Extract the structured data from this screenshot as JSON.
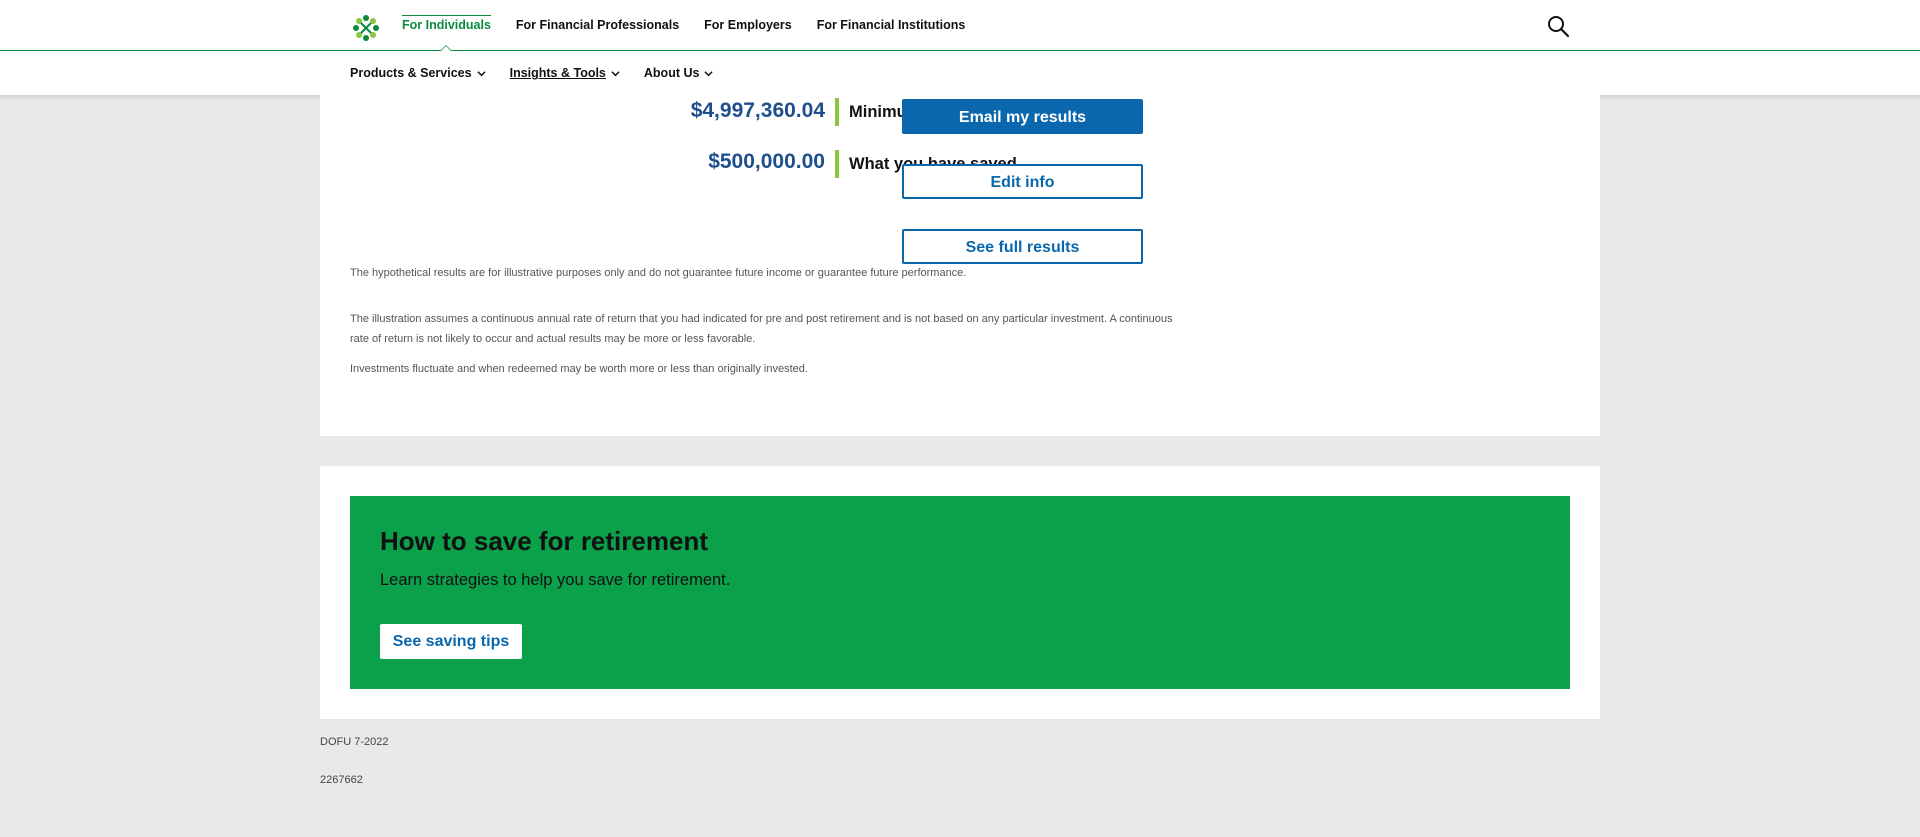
{
  "topnav": {
    "tabs": [
      {
        "label": "For Individuals",
        "active": true
      },
      {
        "label": "For Financial Professionals"
      },
      {
        "label": "For Employers"
      },
      {
        "label": "For Financial Institutions"
      }
    ],
    "search_icon": "search-icon"
  },
  "subnav": {
    "items": [
      {
        "label": "Products & Services"
      },
      {
        "label": "Insights & Tools"
      },
      {
        "label": "About Us"
      }
    ]
  },
  "results": {
    "minimum_amount": "$4,997,360.04",
    "minimum_label": "Minimum needed to retire",
    "saved_amount": "$500,000.00",
    "saved_label": "What you have saved",
    "email_button": "Email my results",
    "edit_button": "Edit info",
    "full_button": "See full results",
    "disclaimer_1": "The hypothetical results are for illustrative purposes only and do not guarantee future income or guarantee future performance.",
    "disclaimer_2": "The illustration assumes a continuous annual rate of return that you had indicated for pre and post retirement and is not based on any particular investment. A continuous rate of return is not likely to occur and actual results may be more or less favorable.",
    "disclaimer_3": "Investments fluctuate and when redeemed may be worth more or less than originally invested."
  },
  "promo": {
    "title": "How to save for retirement",
    "subtitle": "Learn strategies to help you save for retirement.",
    "button": "See saving tips"
  },
  "footer": {
    "dofu": "DOFU 7-2022",
    "code": "2267662"
  },
  "colors": {
    "brand_green": "#0b8a3e",
    "promo_green": "#0ba04a",
    "link_blue": "#0a67ad",
    "amount_blue": "#1f4e8c",
    "accent_bar": "#8cc63f"
  }
}
